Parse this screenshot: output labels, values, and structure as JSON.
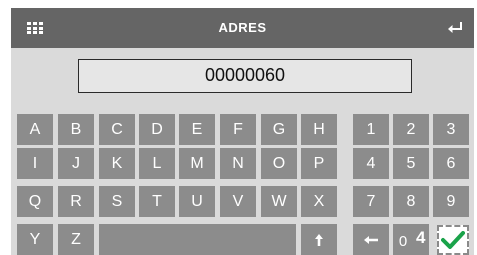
{
  "header": {
    "title": "ADRES",
    "menu_icon": "grid-menu-icon",
    "enter_icon": "enter-return-icon"
  },
  "display": {
    "value": "00000060"
  },
  "keys": {
    "row1": [
      "A",
      "B",
      "C",
      "D",
      "E",
      "F",
      "G",
      "H"
    ],
    "row2": [
      "I",
      "J",
      "K",
      "L",
      "M",
      "N",
      "O",
      "P"
    ],
    "row3": [
      "Q",
      "R",
      "S",
      "T",
      "U",
      "V",
      "W",
      "X"
    ],
    "row4": [
      "Y",
      "Z"
    ],
    "numpad": [
      "1",
      "2",
      "3",
      "4",
      "5",
      "6",
      "7",
      "8",
      "9"
    ],
    "zero": "0",
    "overlay_digit": "4"
  },
  "icons": {
    "shift": "arrow-up-icon",
    "backspace": "arrow-left-icon",
    "confirm": "checkmark-icon"
  },
  "colors": {
    "header_bg": "#656565",
    "key_bg": "#8c8c8c",
    "panel_bg": "#dadada",
    "confirm_check": "#1aa34a"
  }
}
